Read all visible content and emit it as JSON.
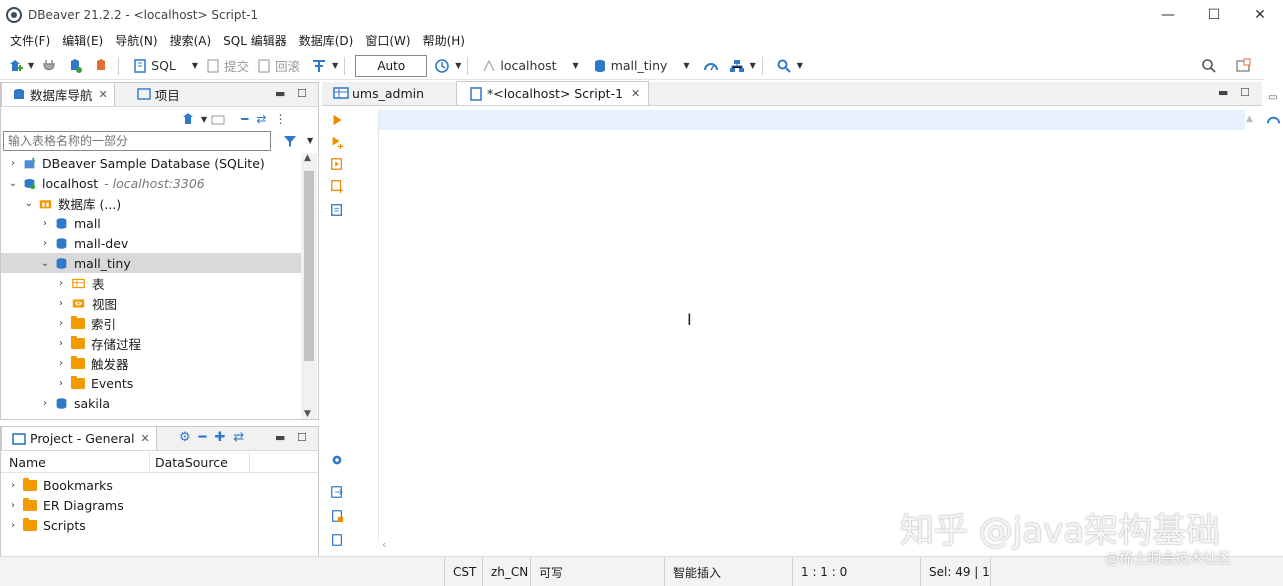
{
  "window": {
    "title": "DBeaver 21.2.2 - <localhost> Script-1",
    "min": "—",
    "max": "☐",
    "close": "✕"
  },
  "menu": [
    "文件(F)",
    "编辑(E)",
    "导航(N)",
    "搜索(A)",
    "SQL 编辑器",
    "数据库(D)",
    "窗口(W)",
    "帮助(H)"
  ],
  "toolbar": {
    "sql": "SQL",
    "commit": "提交",
    "rollback": "回滚",
    "txmode": "Auto",
    "connection": "localhost",
    "database": "mall_tiny"
  },
  "navigator": {
    "tab_nav": "数据库导航",
    "tab_project": "项目",
    "filter_placeholder": "输入表格名称的一部分",
    "rows": [
      {
        "label": "DBeaver Sample Database (SQLite)",
        "extra": ""
      },
      {
        "label": "localhost",
        "extra": "- localhost:3306"
      },
      {
        "label": "数据库 (...)",
        "extra": ""
      },
      {
        "label": "mall",
        "extra": ""
      },
      {
        "label": "mall-dev",
        "extra": ""
      },
      {
        "label": "mall_tiny",
        "extra": ""
      },
      {
        "label": "表",
        "extra": ""
      },
      {
        "label": "视图",
        "extra": ""
      },
      {
        "label": "索引",
        "extra": ""
      },
      {
        "label": "存储过程",
        "extra": ""
      },
      {
        "label": "触发器",
        "extra": ""
      },
      {
        "label": "Events",
        "extra": ""
      },
      {
        "label": "sakila",
        "extra": ""
      }
    ]
  },
  "project": {
    "tab": "Project - General",
    "col_name": "Name",
    "col_ds": "DataSource",
    "items": [
      "Bookmarks",
      "ER Diagrams",
      "Scripts"
    ]
  },
  "editor": {
    "tab1": "ums_admin",
    "tab2": "*<localhost> Script-1"
  },
  "status": {
    "tz": "CST",
    "locale": "zh_CN",
    "mode": "可写",
    "insert": "智能插入",
    "pos": "1 : 1 : 0",
    "sel": "Sel: 49 | 1"
  },
  "watermark": {
    "main": "知乎 @java架构基础",
    "sub": "@稀土掘金技术社区"
  },
  "colors": {
    "accent": "#2b7cd3",
    "folder": "#f29a00",
    "db": "#2f79c8",
    "run": "#f08c00"
  }
}
